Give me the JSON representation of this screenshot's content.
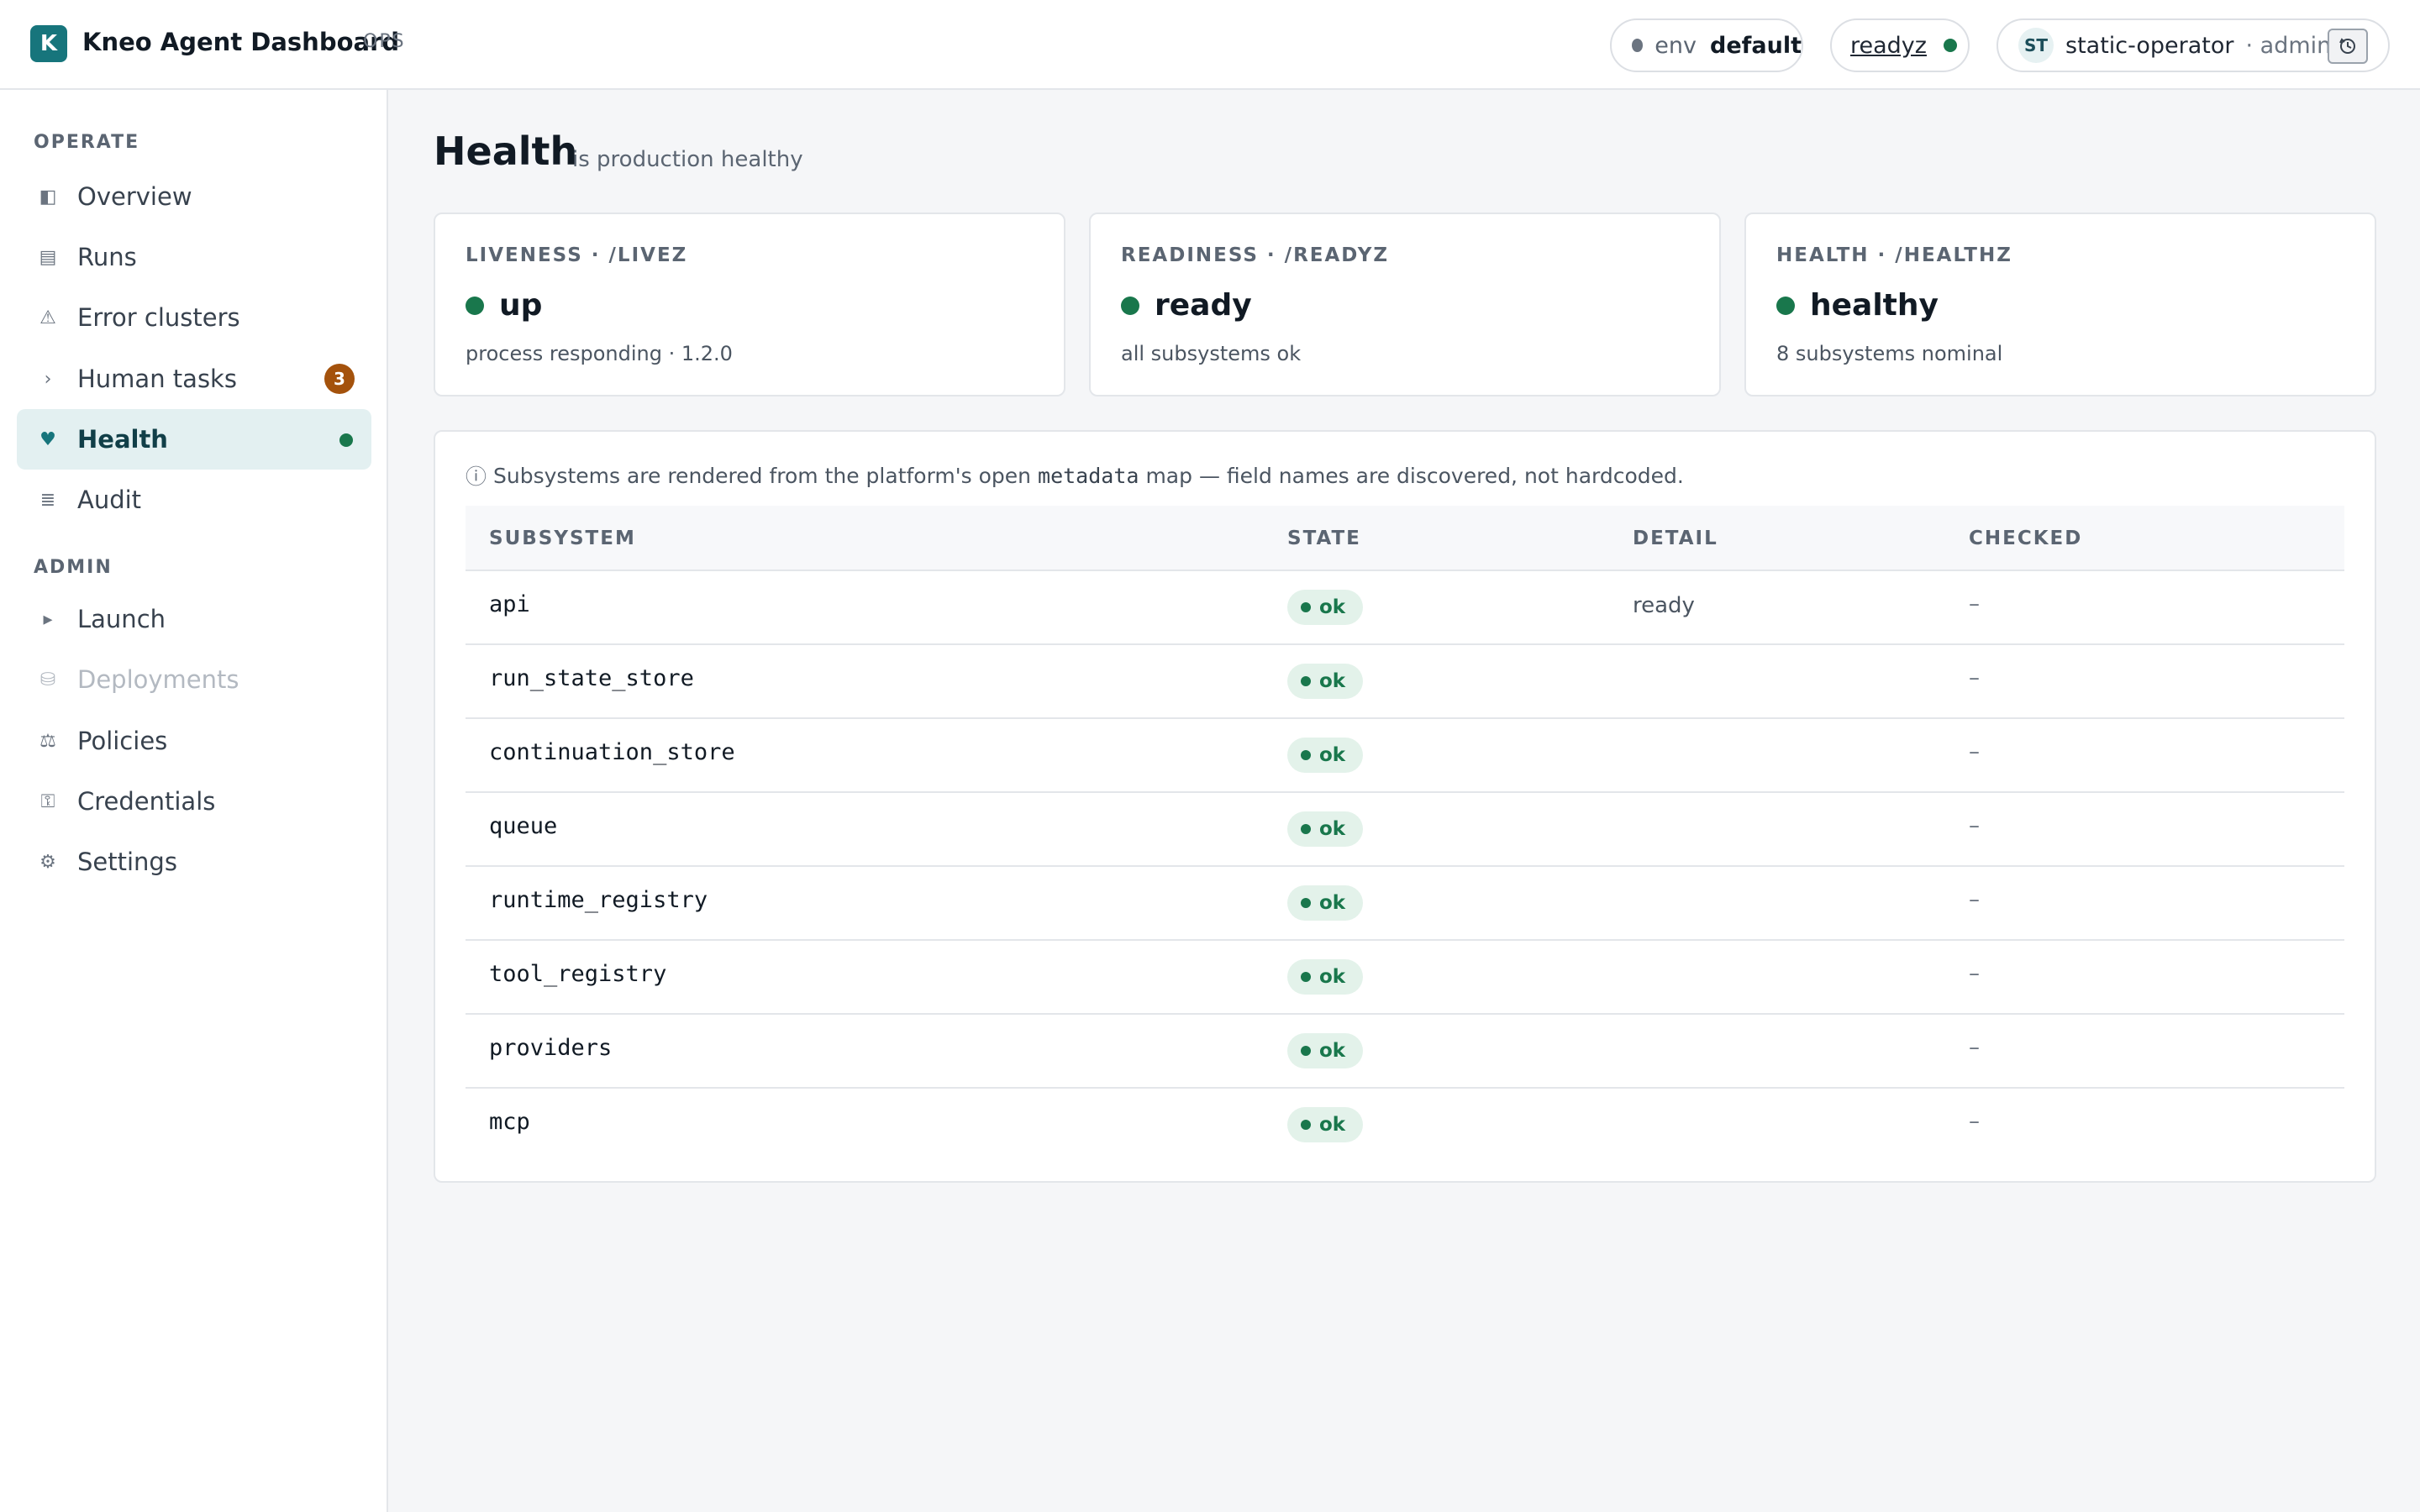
{
  "app": {
    "logo_letter": "K",
    "title": "Kneo Agent Dashboard",
    "tag": "OPS"
  },
  "header": {
    "env_label": "env",
    "env_value": "default",
    "readyz_label": "readyz",
    "user_initials": "ST",
    "user_name": "static-operator",
    "user_role": "· admin"
  },
  "sidebar": {
    "operate_label": "OPERATE",
    "admin_label": "ADMIN",
    "items": [
      {
        "label": "Overview",
        "icon": "◧"
      },
      {
        "label": "Runs",
        "icon": "▤"
      },
      {
        "label": "Error clusters",
        "icon": "⚠"
      },
      {
        "label": "Human tasks",
        "icon": "›",
        "badge": "3"
      },
      {
        "label": "Health",
        "icon": "♥",
        "active": true
      },
      {
        "label": "Audit",
        "icon": "≣"
      },
      {
        "label": "Launch",
        "icon": "▸"
      },
      {
        "label": "Deployments",
        "icon": "⛁",
        "disabled": true
      },
      {
        "label": "Policies",
        "icon": "⚖"
      },
      {
        "label": "Credentials",
        "icon": "⚿"
      },
      {
        "label": "Settings",
        "icon": "⚙"
      }
    ]
  },
  "page": {
    "title": "Health",
    "subtitle": "is production healthy"
  },
  "cards": [
    {
      "label": "LIVENESS · /LIVEZ",
      "status": "up",
      "detail": "process responding · 1.2.0"
    },
    {
      "label": "READINESS · /READYZ",
      "status": "ready",
      "detail": "all subsystems ok"
    },
    {
      "label": "HEALTH · /HEALTHZ",
      "status": "healthy",
      "detail": "8 subsystems nominal"
    }
  ],
  "note": {
    "icon": "ⓘ",
    "before": "Subsystems are rendered from the platform's open",
    "code": "metadata",
    "after": "map — field names are discovered, not hardcoded."
  },
  "table": {
    "headers": [
      "SUBSYSTEM",
      "STATE",
      "DETAIL",
      "CHECKED"
    ],
    "rows": [
      {
        "name": "api",
        "state": "ok",
        "detail": "ready",
        "checked": "–"
      },
      {
        "name": "run_state_store",
        "state": "ok",
        "detail": "",
        "checked": "–"
      },
      {
        "name": "continuation_store",
        "state": "ok",
        "detail": "",
        "checked": "–"
      },
      {
        "name": "queue",
        "state": "ok",
        "detail": "",
        "checked": "–"
      },
      {
        "name": "runtime_registry",
        "state": "ok",
        "detail": "",
        "checked": "–"
      },
      {
        "name": "tool_registry",
        "state": "ok",
        "detail": "",
        "checked": "–"
      },
      {
        "name": "providers",
        "state": "ok",
        "detail": "",
        "checked": "–"
      },
      {
        "name": "mcp",
        "state": "ok",
        "detail": "",
        "checked": "–"
      }
    ]
  },
  "colors": {
    "brand": "#17757c",
    "ok_green": "#19774c",
    "badge_orange": "#a4520c",
    "active_nav_bg": "#e3f0f1"
  }
}
